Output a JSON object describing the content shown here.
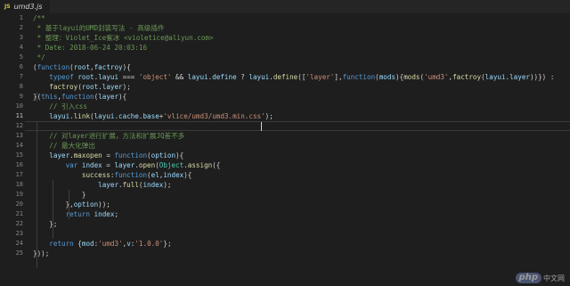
{
  "tab": {
    "icon": "JS",
    "filename": "umd3.js"
  },
  "active_line": 11,
  "colors": {
    "comment": "#6a9955",
    "keyword": "#569cd6",
    "string": "#ce9178",
    "variable": "#9cdcfe",
    "function": "#dcdcaa",
    "text": "#d4d4d4",
    "class": "#4ec9b0"
  },
  "lines": [
    {
      "n": "1",
      "tokens": [
        {
          "t": "/**",
          "c": "com"
        }
      ]
    },
    {
      "n": "2",
      "tokens": [
        {
          "t": " * 基于layui的UMD封装写法 - 高级插件",
          "c": "com"
        }
      ]
    },
    {
      "n": "3",
      "tokens": [
        {
          "t": " * 整理：Violet_Ice紫冰 <violetice@aliyun.com>",
          "c": "com"
        }
      ]
    },
    {
      "n": "4",
      "tokens": [
        {
          "t": " * Date: 2018-06-24 20:03:16",
          "c": "com"
        }
      ]
    },
    {
      "n": "5",
      "tokens": [
        {
          "t": " */",
          "c": "com"
        }
      ]
    },
    {
      "n": "6",
      "tokens": [
        {
          "t": "(",
          "c": "txt"
        },
        {
          "t": "function",
          "c": "kw"
        },
        {
          "t": "(",
          "c": "txt"
        },
        {
          "t": "root",
          "c": "var"
        },
        {
          "t": ",",
          "c": "txt"
        },
        {
          "t": "factroy",
          "c": "var"
        },
        {
          "t": "){",
          "c": "txt"
        }
      ]
    },
    {
      "n": "7",
      "tokens": [
        {
          "t": "    ",
          "c": "txt"
        },
        {
          "t": "typeof",
          "c": "kw"
        },
        {
          "t": " ",
          "c": "txt"
        },
        {
          "t": "root",
          "c": "var"
        },
        {
          "t": ".",
          "c": "txt"
        },
        {
          "t": "layui",
          "c": "var"
        },
        {
          "t": " === ",
          "c": "txt"
        },
        {
          "t": "'object'",
          "c": "str"
        },
        {
          "t": " && ",
          "c": "txt"
        },
        {
          "t": "layui",
          "c": "var"
        },
        {
          "t": ".",
          "c": "txt"
        },
        {
          "t": "define",
          "c": "var"
        },
        {
          "t": " ? ",
          "c": "txt"
        },
        {
          "t": "layui",
          "c": "var"
        },
        {
          "t": ".",
          "c": "txt"
        },
        {
          "t": "define",
          "c": "fn"
        },
        {
          "t": "([",
          "c": "txt"
        },
        {
          "t": "'layer'",
          "c": "str"
        },
        {
          "t": "],",
          "c": "txt"
        },
        {
          "t": "function",
          "c": "kw"
        },
        {
          "t": "(",
          "c": "txt"
        },
        {
          "t": "mods",
          "c": "var"
        },
        {
          "t": "){",
          "c": "txt"
        },
        {
          "t": "mods",
          "c": "fn"
        },
        {
          "t": "(",
          "c": "txt"
        },
        {
          "t": "'umd3'",
          "c": "str"
        },
        {
          "t": ",",
          "c": "txt"
        },
        {
          "t": "factroy",
          "c": "fn"
        },
        {
          "t": "(",
          "c": "txt"
        },
        {
          "t": "layui",
          "c": "var"
        },
        {
          "t": ".",
          "c": "txt"
        },
        {
          "t": "layer",
          "c": "var"
        },
        {
          "t": "))}) : ",
          "c": "txt"
        }
      ]
    },
    {
      "n": "8",
      "tokens": [
        {
          "t": "    ",
          "c": "txt"
        },
        {
          "t": "factroy",
          "c": "fn"
        },
        {
          "t": "(",
          "c": "txt"
        },
        {
          "t": "root",
          "c": "var"
        },
        {
          "t": ".",
          "c": "txt"
        },
        {
          "t": "layer",
          "c": "var"
        },
        {
          "t": ");",
          "c": "txt"
        }
      ]
    },
    {
      "n": "9",
      "tokens": [
        {
          "t": "}(",
          "c": "txt"
        },
        {
          "t": "this",
          "c": "kw"
        },
        {
          "t": ",",
          "c": "txt"
        },
        {
          "t": "function",
          "c": "kw"
        },
        {
          "t": "(",
          "c": "txt"
        },
        {
          "t": "layer",
          "c": "var"
        },
        {
          "t": "){",
          "c": "txt"
        }
      ]
    },
    {
      "n": "10",
      "tokens": [
        {
          "t": "    ",
          "c": "txt"
        },
        {
          "t": "// 引入css",
          "c": "com"
        }
      ]
    },
    {
      "n": "11",
      "tokens": [
        {
          "t": "    ",
          "c": "txt"
        },
        {
          "t": "layui",
          "c": "var"
        },
        {
          "t": ".",
          "c": "txt"
        },
        {
          "t": "link",
          "c": "fn"
        },
        {
          "t": "(",
          "c": "txt"
        },
        {
          "t": "layui",
          "c": "var"
        },
        {
          "t": ".",
          "c": "txt"
        },
        {
          "t": "cache",
          "c": "var"
        },
        {
          "t": ".",
          "c": "txt"
        },
        {
          "t": "base",
          "c": "var"
        },
        {
          "t": "+",
          "c": "txt"
        },
        {
          "t": "'vlice/umd3/umd3.min.css'",
          "c": "str"
        },
        {
          "t": ");",
          "c": "txt"
        }
      ]
    },
    {
      "n": "12",
      "tokens": []
    },
    {
      "n": "13",
      "tokens": [
        {
          "t": "    ",
          "c": "txt"
        },
        {
          "t": "// 对layer进行扩展，方法和扩展JQ差不多",
          "c": "com"
        }
      ]
    },
    {
      "n": "14",
      "tokens": [
        {
          "t": "    ",
          "c": "txt"
        },
        {
          "t": "// 最大化弹出",
          "c": "com"
        }
      ]
    },
    {
      "n": "15",
      "tokens": [
        {
          "t": "    ",
          "c": "txt"
        },
        {
          "t": "layer",
          "c": "var"
        },
        {
          "t": ".",
          "c": "txt"
        },
        {
          "t": "maxopen",
          "c": "fn"
        },
        {
          "t": " = ",
          "c": "txt"
        },
        {
          "t": "function",
          "c": "kw"
        },
        {
          "t": "(",
          "c": "txt"
        },
        {
          "t": "option",
          "c": "var"
        },
        {
          "t": "){",
          "c": "txt"
        }
      ]
    },
    {
      "n": "16",
      "tokens": [
        {
          "t": "        ",
          "c": "txt"
        },
        {
          "t": "var",
          "c": "kw"
        },
        {
          "t": " ",
          "c": "txt"
        },
        {
          "t": "index",
          "c": "var"
        },
        {
          "t": " = ",
          "c": "txt"
        },
        {
          "t": "layer",
          "c": "var"
        },
        {
          "t": ".",
          "c": "txt"
        },
        {
          "t": "open",
          "c": "fn"
        },
        {
          "t": "(",
          "c": "txt"
        },
        {
          "t": "Object",
          "c": "cls"
        },
        {
          "t": ".",
          "c": "txt"
        },
        {
          "t": "assign",
          "c": "fn"
        },
        {
          "t": "({",
          "c": "txt"
        }
      ]
    },
    {
      "n": "17",
      "tokens": [
        {
          "t": "            ",
          "c": "txt"
        },
        {
          "t": "success",
          "c": "fn"
        },
        {
          "t": ":",
          "c": "txt"
        },
        {
          "t": "function",
          "c": "kw"
        },
        {
          "t": "(",
          "c": "txt"
        },
        {
          "t": "el",
          "c": "var"
        },
        {
          "t": ",",
          "c": "txt"
        },
        {
          "t": "index",
          "c": "var"
        },
        {
          "t": "){",
          "c": "txt"
        }
      ]
    },
    {
      "n": "18",
      "tokens": [
        {
          "t": "                ",
          "c": "txt"
        },
        {
          "t": "layer",
          "c": "var"
        },
        {
          "t": ".",
          "c": "txt"
        },
        {
          "t": "full",
          "c": "fn"
        },
        {
          "t": "(",
          "c": "txt"
        },
        {
          "t": "index",
          "c": "var"
        },
        {
          "t": ");",
          "c": "txt"
        }
      ]
    },
    {
      "n": "19",
      "tokens": [
        {
          "t": "            }",
          "c": "txt"
        }
      ]
    },
    {
      "n": "20",
      "tokens": [
        {
          "t": "        },",
          "c": "txt"
        },
        {
          "t": "option",
          "c": "var"
        },
        {
          "t": "));",
          "c": "txt"
        }
      ]
    },
    {
      "n": "21",
      "tokens": [
        {
          "t": "        ",
          "c": "txt"
        },
        {
          "t": "return",
          "c": "kw"
        },
        {
          "t": " ",
          "c": "txt"
        },
        {
          "t": "index",
          "c": "var"
        },
        {
          "t": ";",
          "c": "txt"
        }
      ]
    },
    {
      "n": "22",
      "tokens": [
        {
          "t": "    };",
          "c": "txt"
        }
      ]
    },
    {
      "n": "23",
      "tokens": []
    },
    {
      "n": "24",
      "tokens": [
        {
          "t": "    ",
          "c": "txt"
        },
        {
          "t": "return",
          "c": "kw"
        },
        {
          "t": " {",
          "c": "txt"
        },
        {
          "t": "mod",
          "c": "var"
        },
        {
          "t": ":",
          "c": "txt"
        },
        {
          "t": "'umd3'",
          "c": "str"
        },
        {
          "t": ",",
          "c": "txt"
        },
        {
          "t": "v",
          "c": "var"
        },
        {
          "t": ":",
          "c": "txt"
        },
        {
          "t": "'1.0.0'",
          "c": "str"
        },
        {
          "t": "};",
          "c": "txt"
        }
      ]
    },
    {
      "n": "25",
      "tokens": [
        {
          "t": "}));",
          "c": "txt"
        }
      ]
    }
  ],
  "watermark": {
    "badge": "php",
    "text": "中文网"
  }
}
